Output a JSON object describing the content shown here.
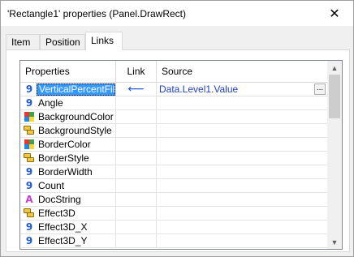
{
  "window": {
    "title": "'Rectangle1' properties (Panel.DrawRect)",
    "close_glyph": "✕"
  },
  "tabs": [
    {
      "label": "Item",
      "active": false
    },
    {
      "label": "Position",
      "active": false
    },
    {
      "label": "Links",
      "active": true
    }
  ],
  "grid": {
    "headers": {
      "properties": "Properties",
      "link": "Link",
      "source": "Source"
    },
    "rows": [
      {
        "name": "VerticalPercentFill",
        "type_icon": "number-icon",
        "glyph": "9",
        "selected": true,
        "link": "⟵",
        "source": "Data.Level1.Value",
        "has_button": true,
        "button_label": "..."
      },
      {
        "name": "Angle",
        "type_icon": "number-icon",
        "glyph": "9"
      },
      {
        "name": "BackgroundColor",
        "type_icon": "color-icon"
      },
      {
        "name": "BackgroundStyle",
        "type_icon": "style-icon"
      },
      {
        "name": "BorderColor",
        "type_icon": "color-icon"
      },
      {
        "name": "BorderStyle",
        "type_icon": "style-icon"
      },
      {
        "name": "BorderWidth",
        "type_icon": "number-icon",
        "glyph": "9"
      },
      {
        "name": "Count",
        "type_icon": "number-icon",
        "glyph": "9"
      },
      {
        "name": "DocString",
        "type_icon": "string-icon",
        "glyph": "A"
      },
      {
        "name": "Effect3D",
        "type_icon": "style-icon"
      },
      {
        "name": "Effect3D_X",
        "type_icon": "number-icon",
        "glyph": "9"
      },
      {
        "name": "Effect3D_Y",
        "type_icon": "number-icon",
        "glyph": "9"
      }
    ]
  },
  "scrollbar": {
    "up_glyph": "▲",
    "down_glyph": "▼"
  },
  "colors": {
    "selection": "#3399ff",
    "number_icon": "#1f5bd4",
    "string_icon": "#c240c2",
    "link_text": "#1f3fbf"
  }
}
